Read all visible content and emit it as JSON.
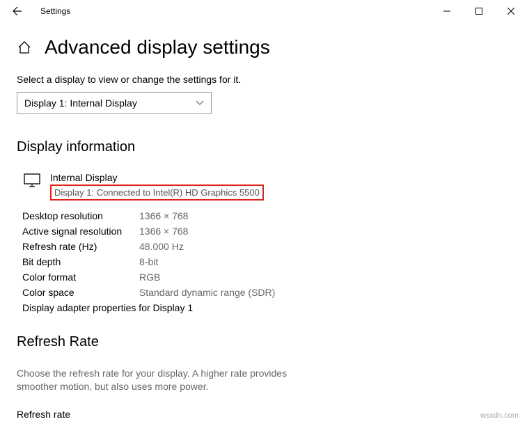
{
  "titlebar": {
    "title": "Settings"
  },
  "page": {
    "heading": "Advanced display settings",
    "instruction": "Select a display to view or change the settings for it.",
    "dropdown_value": "Display 1: Internal Display"
  },
  "display_info": {
    "heading": "Display information",
    "name": "Internal Display",
    "connection": "Display 1: Connected to Intel(R) HD Graphics 5500",
    "rows": [
      {
        "label": "Desktop resolution",
        "value": "1366 × 768"
      },
      {
        "label": "Active signal resolution",
        "value": "1366 × 768"
      },
      {
        "label": "Refresh rate (Hz)",
        "value": "48.000 Hz"
      },
      {
        "label": "Bit depth",
        "value": "8-bit"
      },
      {
        "label": "Color format",
        "value": "RGB"
      },
      {
        "label": "Color space",
        "value": "Standard dynamic range (SDR)"
      }
    ],
    "adapter_link": "Display adapter properties for Display 1"
  },
  "refresh": {
    "heading": "Refresh Rate",
    "description": "Choose the refresh rate for your display. A higher rate provides smoother motion, but also uses more power.",
    "label": "Refresh rate"
  },
  "watermark": "wsxdn.com"
}
